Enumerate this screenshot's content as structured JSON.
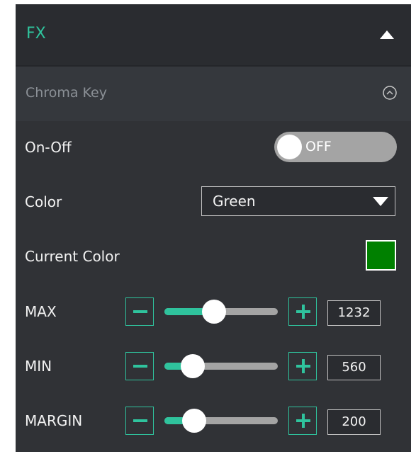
{
  "fx": {
    "title": "FX",
    "accent_color": "#2fc39d",
    "collapse_icon": "triangle-up-icon"
  },
  "chroma_key": {
    "title": "Chroma Key",
    "collapse_icon": "circle-chevron-up-icon",
    "on_off": {
      "label": "On-Off",
      "state": "OFF"
    },
    "color": {
      "label": "Color",
      "selected": "Green",
      "dropdown_icon": "triangle-down-icon"
    },
    "current_color": {
      "label": "Current Color",
      "swatch": "#008000"
    },
    "sliders": [
      {
        "label": "MAX",
        "value": "1232",
        "level": 0.44,
        "minus_icon": "minus-icon",
        "plus_icon": "plus-icon"
      },
      {
        "label": "MIN",
        "value": "560",
        "level": 0.25,
        "minus_icon": "minus-icon",
        "plus_icon": "plus-icon"
      },
      {
        "label": "MARGIN",
        "value": "200",
        "level": 0.26,
        "minus_icon": "minus-icon",
        "plus_icon": "plus-icon"
      }
    ]
  }
}
